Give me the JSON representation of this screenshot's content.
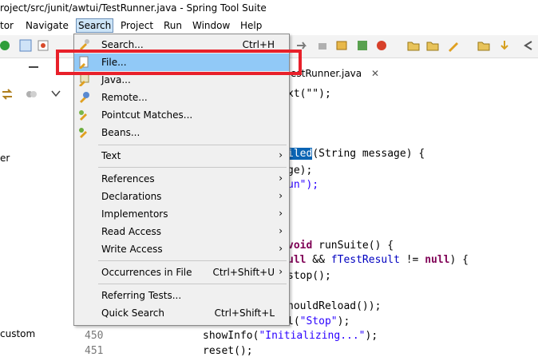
{
  "window": {
    "title": "roject/src/junit/awtui/TestRunner.java - Spring Tool Suite"
  },
  "menubar": {
    "items": [
      "tor",
      "Navigate",
      "Search",
      "Project",
      "Run",
      "Window",
      "Help"
    ]
  },
  "left_panel": {
    "text_er": "er",
    "text_custom": "custom"
  },
  "editor": {
    "tab_label": "estRunner.java",
    "tab_close": "✕",
    "lines": {
      "l1": "xt(\"\");",
      "l2a": "iled",
      "l2b": "(String message) {",
      "l3": "ge);",
      "l4": "un\");",
      "l5a": "void",
      "l5b": " runSuite() {",
      "l6a": "ull",
      "l6b": " && ",
      "l6c": "fTestResult",
      "l6d": " != ",
      "l6e": "null",
      "l6f": ") {",
      "l7": "stop();",
      "l8": "houldReload());",
      "l9a": "l(",
      "l9b": "\"Stop\"",
      "l9c": ");",
      "l10a": "showInfo(",
      "l10b": "\"Initializing...\"",
      "l10c": ");",
      "l11": "reset();"
    },
    "line_numbers": [
      "450",
      "451"
    ]
  },
  "search_menu": {
    "items": [
      {
        "label": "Search...",
        "accel": "Ctrl+H",
        "icon": "flashlight-icon"
      },
      {
        "label": "File...",
        "accel": "",
        "icon": "file-search-icon"
      },
      {
        "label": "Java...",
        "accel": "",
        "icon": "java-search-icon"
      },
      {
        "label": "Remote...",
        "accel": "",
        "icon": "remote-search-icon"
      },
      {
        "label": "Pointcut Matches...",
        "accel": "",
        "icon": "pointcut-icon"
      },
      {
        "label": "Beans...",
        "accel": "",
        "icon": "beans-icon"
      },
      {
        "label": "Text",
        "accel": "",
        "submenu": true
      },
      {
        "label": "References",
        "accel": "",
        "submenu": true
      },
      {
        "label": "Declarations",
        "accel": "",
        "submenu": true
      },
      {
        "label": "Implementors",
        "accel": "",
        "submenu": true
      },
      {
        "label": "Read Access",
        "accel": "",
        "submenu": true
      },
      {
        "label": "Write Access",
        "accel": "",
        "submenu": true
      },
      {
        "label": "Occurrences in File",
        "accel": "Ctrl+Shift+U",
        "submenu": true
      },
      {
        "label": "Referring Tests...",
        "accel": ""
      },
      {
        "label": "Quick Search",
        "accel": "Ctrl+Shift+L"
      }
    ],
    "submenu_arrow": "›"
  },
  "colors": {
    "highlight_box": "#e8202a",
    "menu_hover": "#91c9f7"
  }
}
